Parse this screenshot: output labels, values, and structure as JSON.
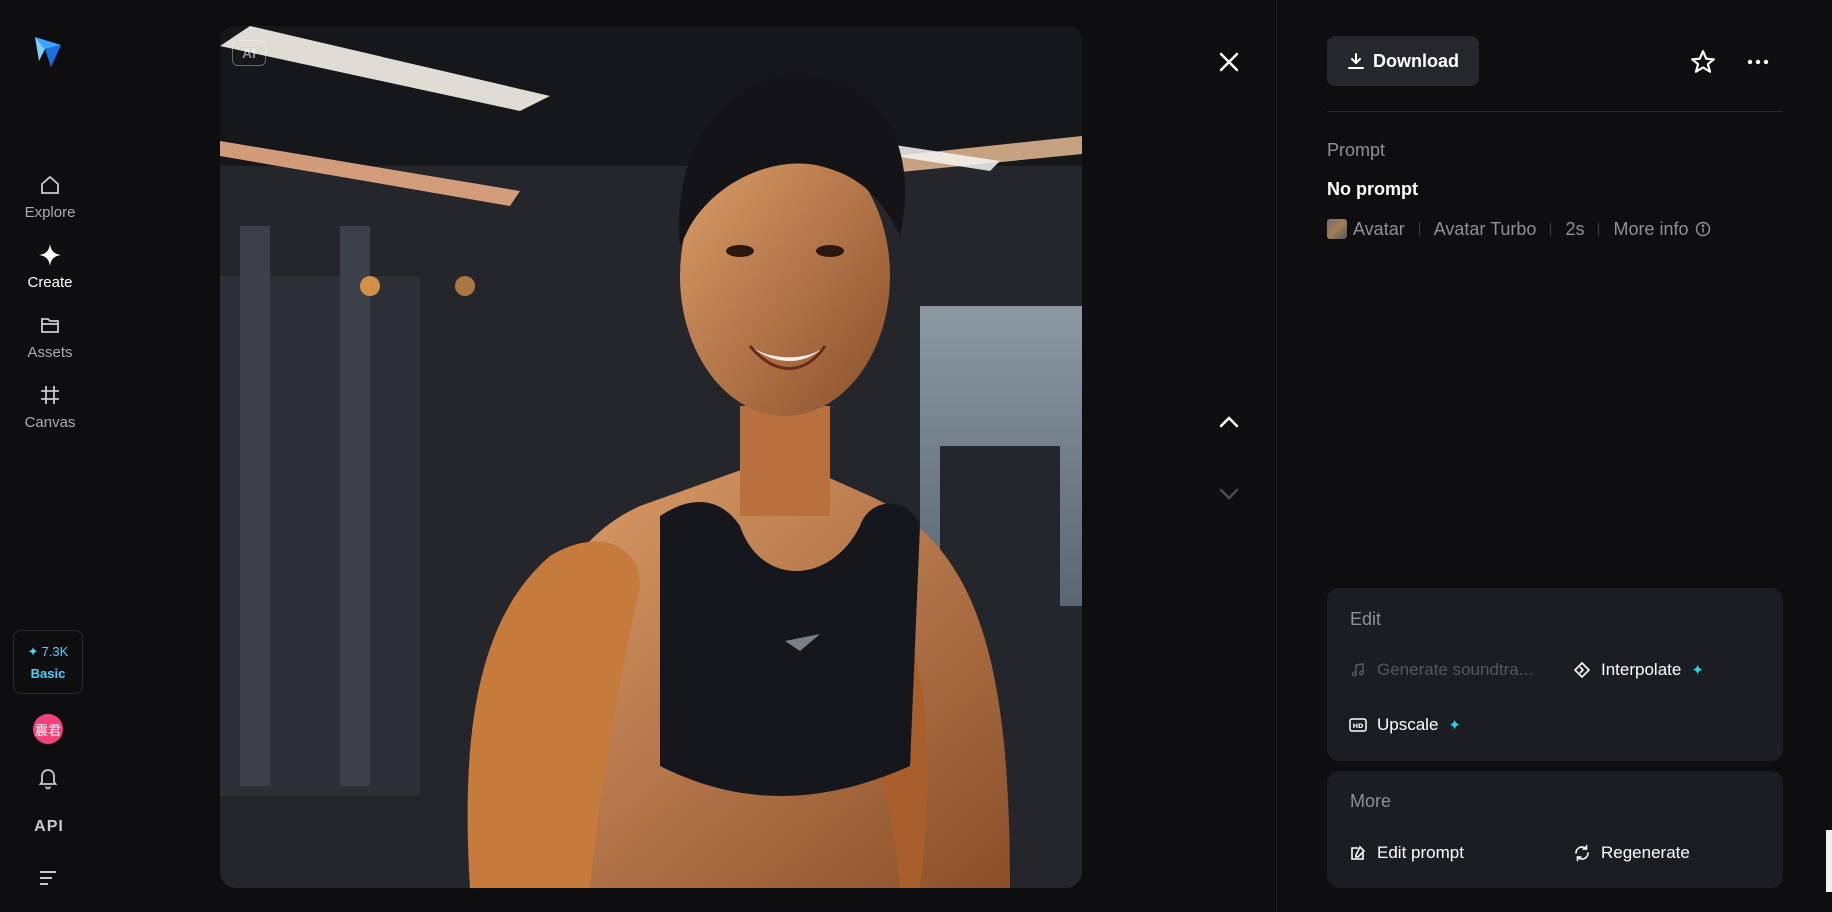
{
  "sidebar": {
    "items": [
      {
        "label": "Explore",
        "icon": "home-icon"
      },
      {
        "label": "Create",
        "icon": "sparkle-icon"
      },
      {
        "label": "Assets",
        "icon": "folder-icon"
      },
      {
        "label": "Canvas",
        "icon": "frame-icon"
      }
    ],
    "credits": {
      "amount": "7.3K",
      "plan": "Basic"
    },
    "avatar_text": "震君",
    "api_label": "API"
  },
  "viewer": {
    "ai_badge": "AI"
  },
  "details": {
    "download_label": "Download",
    "prompt_label": "Prompt",
    "prompt_value": "No prompt",
    "meta": {
      "model_family": "Avatar",
      "model_name": "Avatar Turbo",
      "duration": "2s",
      "more_info": "More info"
    },
    "edit_panel": {
      "title": "Edit",
      "actions": [
        {
          "label": "Generate soundtra...",
          "enabled": false
        },
        {
          "label": "Interpolate",
          "enabled": true
        },
        {
          "label": "Upscale",
          "enabled": true
        }
      ]
    },
    "more_panel": {
      "title": "More",
      "actions": [
        {
          "label": "Edit prompt"
        },
        {
          "label": "Regenerate"
        }
      ]
    }
  },
  "colors": {
    "background": "#0e0e10",
    "panel": "#1c1d22",
    "accent": "#22d3ee",
    "avatar_bg": "#f0437a"
  }
}
